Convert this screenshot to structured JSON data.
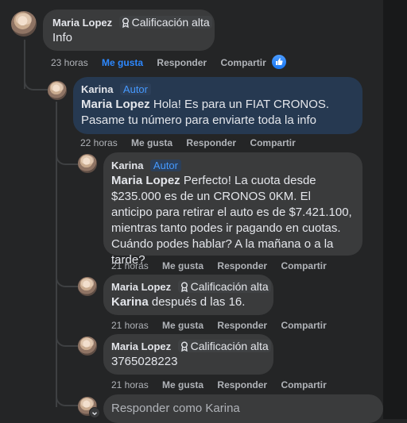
{
  "comments": [
    {
      "author": "Maria Lopez",
      "badge": "Calificación alta",
      "mention": "",
      "text": "Info",
      "time": "23 horas",
      "like": "Me gusta",
      "reply": "Responder",
      "share": "Compartir",
      "liked": true
    },
    {
      "author": "Karina",
      "badge": "Autor",
      "mention": "Maria Lopez",
      "text": "Hola! Es para un FIAT CRONOS. Pasame tu número para enviarte toda la info",
      "time": "22 horas",
      "like": "Me gusta",
      "reply": "Responder",
      "share": "Compartir"
    },
    {
      "author": "Karina",
      "badge": "Autor",
      "mention": "Maria Lopez",
      "text": "Perfecto! La cuota desde $235.000 es de un CRONOS 0KM. El anticipo para retirar el auto es de $7.421.100, mientras tanto podes ir pagando en cuotas. Cuándo podes hablar? A la mañana o a la tarde?",
      "time": "21 horas",
      "like": "Me gusta",
      "reply": "Responder",
      "share": "Compartir"
    },
    {
      "author": "Maria Lopez",
      "badge": "Calificación alta",
      "mention": "Karina",
      "text": "después d las 16.",
      "time": "21 horas",
      "like": "Me gusta",
      "reply": "Responder",
      "share": "Compartir"
    },
    {
      "author": "Maria Lopez",
      "badge": "Calificación alta",
      "mention": "",
      "text": "3765028223",
      "time": "21 horas",
      "like": "Me gusta",
      "reply": "Responder",
      "share": "Compartir"
    }
  ],
  "reply_box": {
    "placeholder": "Responder como Karina"
  },
  "icons": {
    "badge": "top-fan-badge-icon",
    "like": "thumbs-up-icon",
    "chevron": "chevron-down-icon"
  },
  "colors": {
    "author_bubble": "#263951",
    "link_blue": "#2d88ff"
  }
}
